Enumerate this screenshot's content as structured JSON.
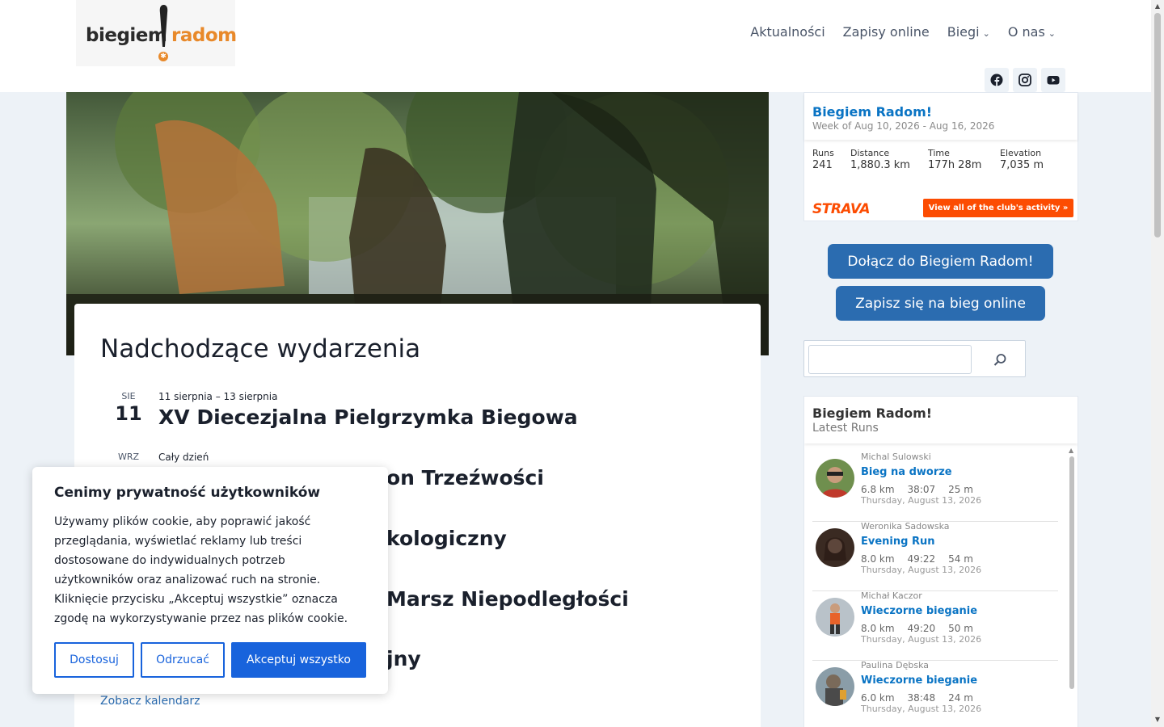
{
  "logo": {
    "part1": "biegiem",
    "part2": "radom"
  },
  "nav": {
    "items": [
      {
        "label": "Aktualności",
        "dropdown": false
      },
      {
        "label": "Zapisy online",
        "dropdown": false
      },
      {
        "label": "Biegi",
        "dropdown": true
      },
      {
        "label": "O nas",
        "dropdown": true
      }
    ]
  },
  "social": {
    "icons": [
      "facebook-icon",
      "instagram-icon",
      "youtube-icon"
    ]
  },
  "events": {
    "title": "Nadchodzące wydarzenia",
    "items": [
      {
        "month": "SIE",
        "day": "11",
        "date": "11 sierpnia – 13 sierpnia",
        "title": "XV Diecezjalna Pielgrzymka Biegowa"
      },
      {
        "month": "WRZ",
        "day": "",
        "date": "Cały dzień",
        "title": "on Trzeźwości"
      },
      {
        "month": "",
        "day": "",
        "date": "",
        "title": "kologiczny"
      },
      {
        "month": "",
        "day": "",
        "date": "",
        "title": "Marsz Niepodległości"
      },
      {
        "month": "",
        "day": "",
        "date": "",
        "title": "jny"
      }
    ],
    "calendar_link": "Zobacz kalendarz"
  },
  "cookie": {
    "title": "Cenimy prywatność użytkowników",
    "text": "Używamy plików cookie, aby poprawić jakość przeglądania, wyświetlać reklamy lub treści dostosowane do indywidualnych potrzeb użytkowników oraz analizować ruch na stronie. Kliknięcie przycisku „Akceptuj wszystkie” oznacza zgodę na wykorzystywanie przez nas plików cookie.",
    "customize": "Dostosuj",
    "reject": "Odrzucać",
    "accept": "Akceptuj wszystko"
  },
  "strava_summary": {
    "club": "Biegiem Radom!",
    "week": "Week of Aug 10, 2026 - Aug 16, 2026",
    "stats": [
      {
        "label": "Runs",
        "value": "241"
      },
      {
        "label": "Distance",
        "value": "1,880.3 km"
      },
      {
        "label": "Time",
        "value": "177h 28m"
      },
      {
        "label": "Elevation",
        "value": "7,035 m"
      }
    ],
    "brand": "STRAVA",
    "view_all": "View all of the club's activity »"
  },
  "buttons": {
    "join": "Dołącz do Biegiem Radom!",
    "signup": "Zapisz się na bieg online"
  },
  "search": {
    "placeholder": ""
  },
  "latest_runs": {
    "club": "Biegiem Radom!",
    "subtitle": "Latest Runs",
    "runs": [
      {
        "athlete": "Michal Sulowski",
        "name": "Bieg na dworze",
        "distance": "6.8 km",
        "time": "38:07",
        "elevation": "25 m",
        "date": "Thursday, August 13, 2026"
      },
      {
        "athlete": "Weronika Sadowska",
        "name": "Evening Run",
        "distance": "8.0 km",
        "time": "49:22",
        "elevation": "54 m",
        "date": "Thursday, August 13, 2026"
      },
      {
        "athlete": "Michał Kaczor",
        "name": "Wieczorne bieganie",
        "distance": "8.0 km",
        "time": "49:20",
        "elevation": "50 m",
        "date": "Thursday, August 13, 2026"
      },
      {
        "athlete": "Paulina Dębska",
        "name": "Wieczorne bieganie",
        "distance": "6.0 km",
        "time": "38:48",
        "elevation": "24 m",
        "date": "Thursday, August 13, 2026"
      }
    ]
  },
  "colors": {
    "accent": "#2b6cb0",
    "strava": "#fc4c02",
    "cookie": "#1863dc",
    "logo_orange": "#e8892a"
  }
}
